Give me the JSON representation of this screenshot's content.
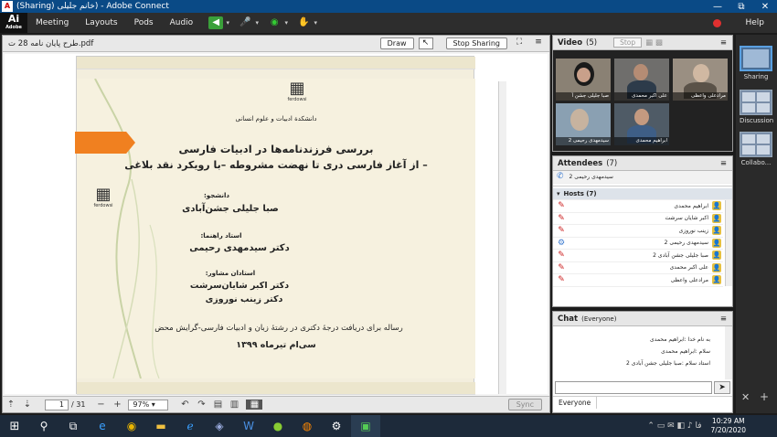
{
  "window": {
    "title": "(Sharing) خانم جلیلی) - Adobe Connect",
    "controls": [
      "—",
      "⧉",
      "✕"
    ]
  },
  "menubar": {
    "logo": "Ai",
    "logo_sub": "Adobe",
    "items": [
      "Meeting",
      "Layouts",
      "Pods",
      "Audio"
    ],
    "help": "Help"
  },
  "share": {
    "filename": "طرح پایان نامه 28 ت.pdf",
    "draw": "Draw",
    "stop_sharing": "Stop Sharing",
    "page_current": "1",
    "page_total": "/ 31",
    "zoom": "97%",
    "sync": "Sync"
  },
  "slide": {
    "faculty": "دانشکدة ادبیات و علوم انسانی",
    "title1": "بررسی فرزندنامه‌ها در ادبیات فارسی",
    "title2": "– از آغاز فارسی دری تا نهضت مشروطه –با رویکرد نقد بلاغی",
    "student_label": "دانشجو:",
    "student": "صبا جلیلی جشن‌آبادی",
    "advisor_label": "استاد راهنما:",
    "advisor": "دکتر سیدمهدی رحیمی",
    "consult_label": "استادان مشاور:",
    "consult1": "دکتر اکبر شایان‌سرشت",
    "consult2": "دکتر زینب نوروزی",
    "thesis": "رساله برای دریافت درجهٔ دکتری در رشتهٔ زبان و ادبیات فارسی-گرایش محض",
    "date": "سی‌ام تیرماه ۱۳۹۹"
  },
  "video": {
    "title": "Video",
    "count": "(5)",
    "stop": "Stop",
    "tiles": [
      "صبا جلیلی جشن آ",
      "علی اکبر محمدی",
      "مرادعلی واعظی",
      "سیدمهدی رحیمی 2",
      "ابراهیم محمدی"
    ]
  },
  "attendees": {
    "title": "Attendees",
    "count": "(7)",
    "presenter": "سیدمهدی رحیمی 2",
    "hosts_label": "Hosts (7)",
    "hosts": [
      "ابراهیم محمدی",
      "اکبر شایان سرشت",
      "زینب نوروزی",
      "سیدمهدی رحیمی 2",
      "صبا جلیلی جشن آبادی 2",
      "علی اکبر محمدی",
      "مرادعلی واعظی"
    ]
  },
  "chat": {
    "title": "Chat",
    "scope": "(Everyone)",
    "tab": "Everyone",
    "messages": [
      "به نام خدا :ابراهیم محمدی",
      "سلام :ابراهیم محمدی",
      "استاد سلام :صبا جلیلی جشن آبادی 2"
    ]
  },
  "layouts": [
    "Sharing",
    "Discussion",
    "Collabo..."
  ],
  "clock": {
    "time": "10:29 AM",
    "date": "7/20/2020"
  },
  "colors": {
    "titlebar": "#0a4a86",
    "menubar": "#2d2d2d",
    "accent_orange": "#f08020",
    "taskbar": "#1d2a3a"
  }
}
